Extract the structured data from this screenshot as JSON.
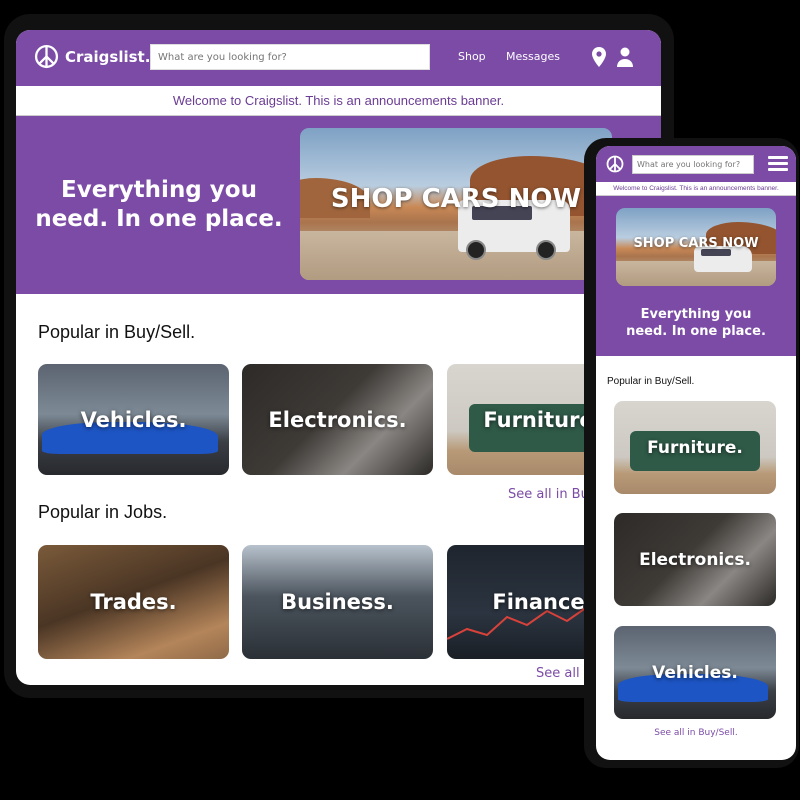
{
  "brand": {
    "name": "Craigslist.",
    "purple": "#7b4ba6",
    "banner_text_color": "#6a3c93"
  },
  "desktop": {
    "search_placeholder": "What are you looking for?",
    "nav": {
      "shop": "Shop",
      "messages": "Messages",
      "location_icon": "location-pin-icon",
      "account_icon": "user-icon"
    },
    "banner": "Welcome to Craigslist. This is an announcements banner.",
    "hero": {
      "tagline_line1": "Everything you",
      "tagline_line2": "need. In one place.",
      "promo": "SHOP CARS NOW"
    },
    "sections": [
      {
        "title": "Popular in Buy/Sell.",
        "tiles": [
          "Vehicles.",
          "Electronics.",
          "Furniture."
        ],
        "see_all": "See all in Buy/Sell."
      },
      {
        "title": "Popular in Jobs.",
        "tiles": [
          "Trades.",
          "Business.",
          "Finance."
        ],
        "see_all": "See all in Jobs."
      }
    ]
  },
  "mobile": {
    "search_placeholder": "What are you looking for?",
    "menu_icon": "hamburger-menu-icon",
    "banner": "Welcome to Craigslist. This is an announcements banner.",
    "hero": {
      "promo": "SHOP CARS NOW",
      "tagline_line1": "Everything you",
      "tagline_line2": "need. In one place."
    },
    "section": {
      "title": "Popular in Buy/Sell.",
      "tiles": [
        "Furniture.",
        "Electronics.",
        "Vehicles."
      ],
      "see_all": "See all in Buy/Sell."
    }
  }
}
